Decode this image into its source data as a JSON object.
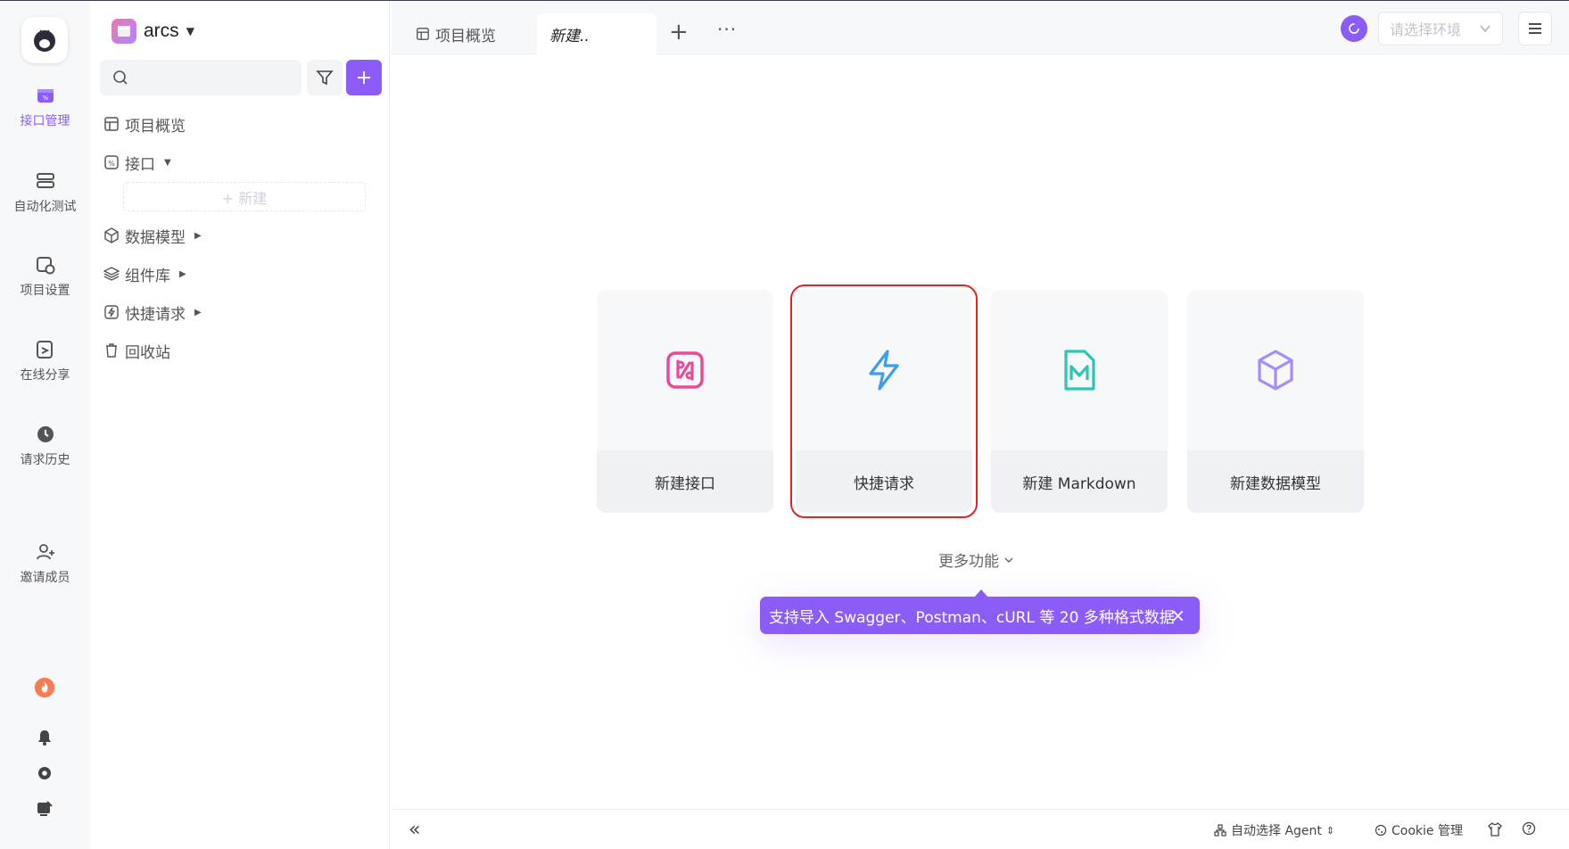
{
  "rail": {
    "items": [
      {
        "label": "接口管理",
        "icon": "api-icon",
        "active": true
      },
      {
        "label": "自动化测试",
        "icon": "layers-icon"
      },
      {
        "label": "项目设置",
        "icon": "project-settings-icon"
      },
      {
        "label": "在线分享",
        "icon": "share-icon"
      },
      {
        "label": "请求历史",
        "icon": "history-icon"
      },
      {
        "label": "邀请成员",
        "icon": "add-user-icon"
      }
    ]
  },
  "sidebar": {
    "project_name": "arcs",
    "search_placeholder": "",
    "tree": [
      {
        "label": "项目概览",
        "icon": "overview-icon"
      },
      {
        "label": "接口",
        "icon": "api-icon"
      },
      {
        "label": "数据模型",
        "icon": "cube-icon"
      },
      {
        "label": "组件库",
        "icon": "stack-icon"
      },
      {
        "label": "快捷请求",
        "icon": "bolt-icon"
      },
      {
        "label": "回收站",
        "icon": "trash-icon"
      }
    ],
    "new_label": "+ 新建"
  },
  "tabs": [
    {
      "label": "项目概览"
    },
    {
      "label": "新建.."
    }
  ],
  "env": {
    "placeholder": "请选择环境"
  },
  "cards": [
    {
      "label": "新建接口",
      "icon": "api-icon",
      "color": "#ec4899"
    },
    {
      "label": "快捷请求",
      "icon": "bolt-icon",
      "color": "#3b9ef0"
    },
    {
      "label": "新建 Markdown",
      "icon": "markdown-icon",
      "color": "#2ec4b6"
    },
    {
      "label": "新建数据模型",
      "icon": "cube-icon",
      "color": "#a78bfa"
    }
  ],
  "more_features": "更多功能",
  "toast": {
    "text": "支持导入 Swagger、Postman、cURL 等 20 多种格式数据",
    "close": "×"
  },
  "bottom": {
    "agent": "自动选择 Agent",
    "cookie": "Cookie 管理"
  },
  "colors": {
    "accent": "#8b5cf6",
    "highlight": "#e02424"
  }
}
